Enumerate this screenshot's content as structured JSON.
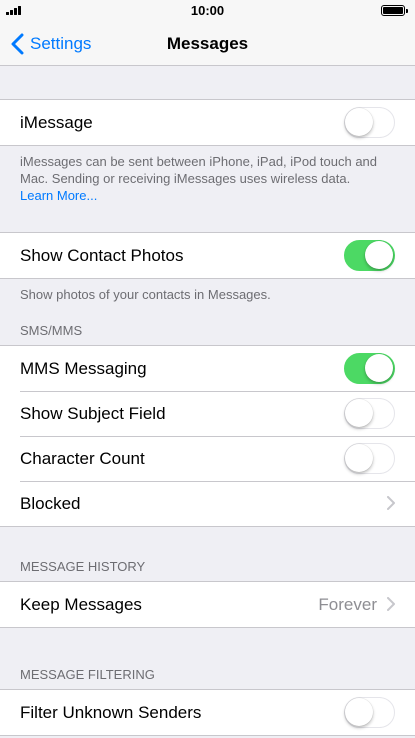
{
  "status_bar": {
    "time": "10:00"
  },
  "nav": {
    "back_label": "Settings",
    "title": "Messages"
  },
  "imessage": {
    "label": "iMessage",
    "enabled": false,
    "footer": "iMessages can be sent between iPhone, iPad, iPod touch and Mac. Sending or receiving iMessages uses wireless data.",
    "footer_link": "Learn More..."
  },
  "contact_photos": {
    "label": "Show Contact Photos",
    "enabled": true,
    "footer": "Show photos of your contacts in Messages."
  },
  "sms_mms": {
    "header": "SMS/MMS",
    "items": [
      {
        "label": "MMS Messaging",
        "enabled": true
      },
      {
        "label": "Show Subject Field",
        "enabled": false
      },
      {
        "label": "Character Count",
        "enabled": false
      }
    ],
    "blocked_label": "Blocked"
  },
  "message_history": {
    "header": "MESSAGE HISTORY",
    "keep_label": "Keep Messages",
    "keep_value": "Forever"
  },
  "message_filtering": {
    "header": "MESSAGE FILTERING",
    "filter_label": "Filter Unknown Senders",
    "filter_enabled": false
  },
  "colors": {
    "accent": "#007aff",
    "toggle_on": "#4cd964",
    "background": "#efeff4"
  }
}
